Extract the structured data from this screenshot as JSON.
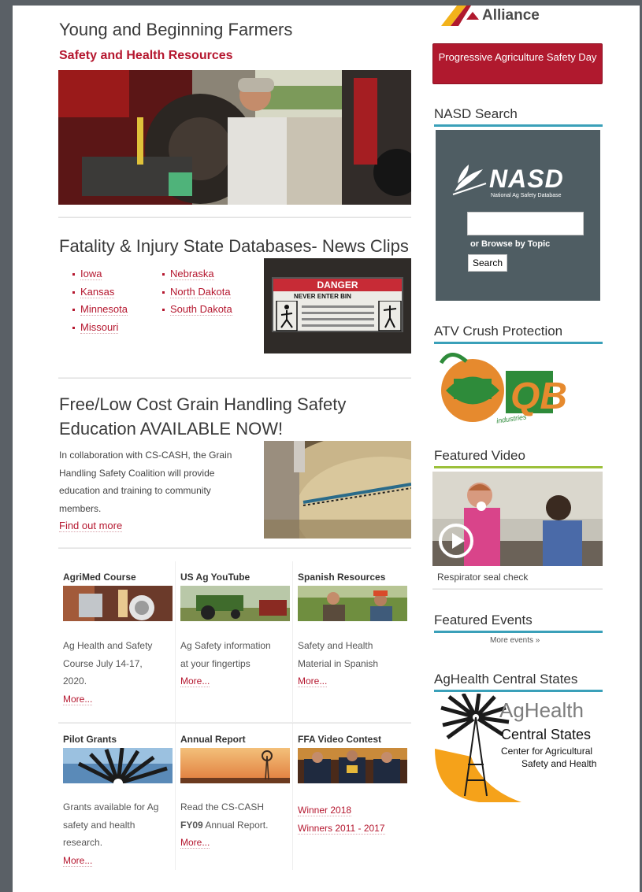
{
  "header": {
    "alliance_text": "Alliance"
  },
  "young_farmers": {
    "title": "Young and Beginning Farmers",
    "link": "Safety and Health Resources"
  },
  "fatality": {
    "title": "Fatality & Injury State Databases- News Clips",
    "states_col1": [
      "Iowa",
      "Kansas",
      "Minnesota",
      "Missouri"
    ],
    "states_col2": [
      "Nebraska",
      "North Dakota",
      "South Dakota"
    ],
    "danger_sign": {
      "header": "DANGER",
      "sub": "NEVER ENTER BIN"
    }
  },
  "grain": {
    "title_line1": "Free/Low Cost Grain Handling Safety",
    "title_line2": "Education AVAILABLE NOW!",
    "body": [
      "In collaboration with CS-CASH, the Grain",
      "Handling Safety Coalition will provide",
      "education and training to community",
      "members."
    ],
    "link": "Find out more"
  },
  "tiles_row1": [
    {
      "title": "AgriMed Course",
      "text": [
        "Ag Health and Safety",
        "Course July 14-17,",
        "2020."
      ],
      "more": "More..."
    },
    {
      "title": "US Ag YouTube",
      "text": [
        "Ag Safety information",
        "at your fingertips"
      ],
      "more": "More..."
    },
    {
      "title": "Spanish Resources",
      "text": [
        "Safety and Health",
        "Material in Spanish"
      ],
      "more": "More..."
    }
  ],
  "tiles_row2": [
    {
      "title": "Pilot Grants",
      "text": [
        "Grants available for Ag",
        "safety and health",
        "research."
      ],
      "more": "More..."
    },
    {
      "title": "Annual Report",
      "text_a": "Read the CS-CASH",
      "text_b_bold": "FY09",
      "text_b_rest": " Annual Report.",
      "more": "More..."
    },
    {
      "title": "FFA Video Contest",
      "links": [
        "Winner 2018",
        "Winners 2011 - 2017"
      ]
    }
  ],
  "sidebar": {
    "progressive_button": "Progressive Agriculture Safety Day",
    "nasd_title": "NASD Search",
    "nasd_logo": "NASD",
    "nasd_tagline": "National Ag Safety Database",
    "nasd_browse": "or Browse by Topic",
    "nasd_search_btn": "Search",
    "atv_title": "ATV Crush Protection",
    "atv_logo_sub": "industries",
    "video_title": "Featured Video",
    "video_caption": "Respirator seal check",
    "events_title": "Featured Events",
    "events_more": "More events »",
    "aghealth_title": "AgHealth Central States",
    "aghealth_logo_line1": "AgHealth",
    "aghealth_logo_line2": "Central States",
    "aghealth_logo_line3": "Center for Agricultural",
    "aghealth_logo_line4": "Safety and Health"
  }
}
